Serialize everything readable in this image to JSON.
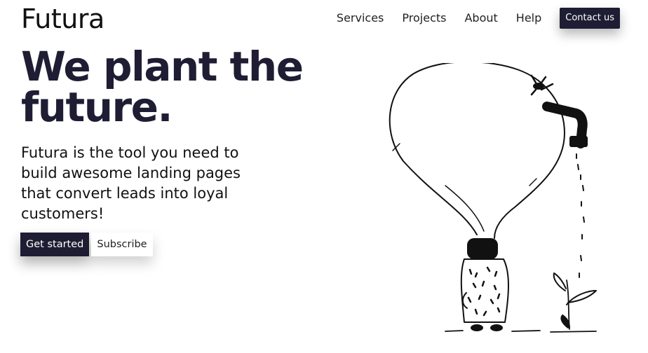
{
  "header": {
    "logo": "Futura",
    "nav": [
      "Services",
      "Projects",
      "About",
      "Help"
    ],
    "contact_label": "Contact us"
  },
  "hero": {
    "title": "We plant the future.",
    "description": "Futura is the tool you need to build awesome landing pages that convert leads into loyal customers!",
    "primary_button": "Get started",
    "secondary_button": "Subscribe"
  },
  "illustration": {
    "icon": "lightbulb-faucet-plant-illustration"
  },
  "colors": {
    "accent": "#1f1d33",
    "background": "#ffffff"
  }
}
